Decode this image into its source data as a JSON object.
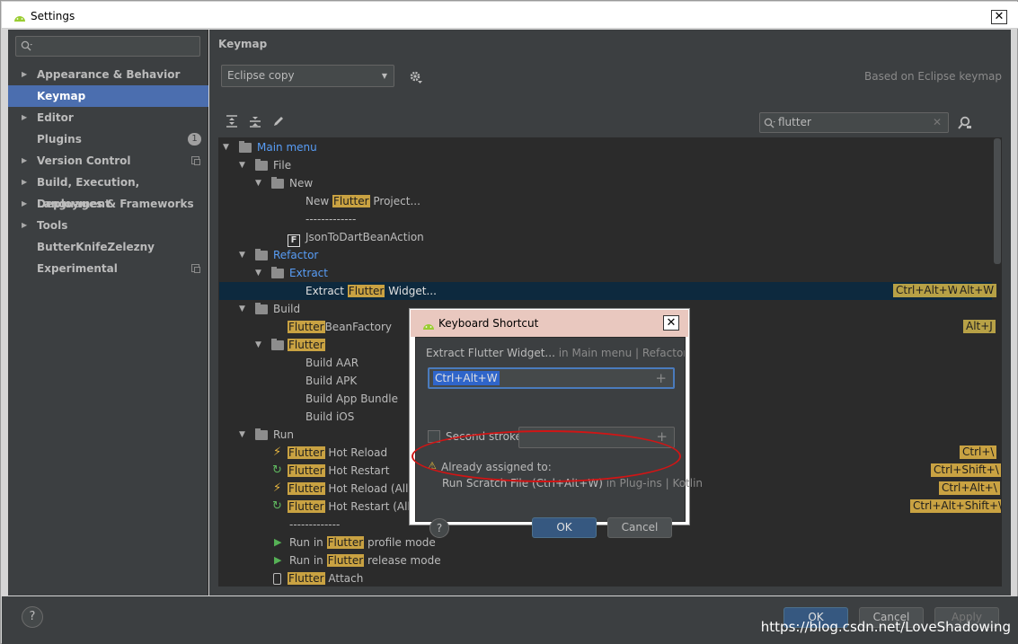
{
  "window": {
    "title": "Settings",
    "close": "✕"
  },
  "sidebar": {
    "search_placeholder": "",
    "items": [
      {
        "label": "Appearance & Behavior",
        "arrow": "▶"
      },
      {
        "label": "Keymap"
      },
      {
        "label": "Editor",
        "arrow": "▶"
      },
      {
        "label": "Plugins",
        "badge": "1"
      },
      {
        "label": "Version Control",
        "arrow": "▶"
      },
      {
        "label": "Build, Execution, Deployment",
        "arrow": "▶"
      },
      {
        "label": "Languages & Frameworks",
        "arrow": "▶"
      },
      {
        "label": "Tools",
        "arrow": "▶"
      },
      {
        "label": "ButterKnifeZelezny"
      },
      {
        "label": "Experimental"
      }
    ]
  },
  "main": {
    "heading": "Keymap",
    "keymap_select": "Eclipse copy",
    "based_on": "Based on Eclipse keymap",
    "filter_value": "flutter",
    "filter_clear": "✕"
  },
  "tree": {
    "main_menu": "Main menu",
    "file": "File",
    "new": "New",
    "new_flutter_project": {
      "pre": "New ",
      "hl": "Flutter",
      "post": " Project..."
    },
    "separator": "-------------",
    "json_to_dart": "JsonToDartBeanAction",
    "refactor": "Refactor",
    "extract": "Extract",
    "extract_widget": {
      "pre": "Extract ",
      "hl": "Flutter",
      "post": " Widget...",
      "sc1": "Ctrl+Alt+W",
      "sc2": "Alt+W"
    },
    "build": "Build",
    "flutter_bean_factory": {
      "hl": "Flutter",
      "post": "BeanFactory",
      "sc": "Alt+J"
    },
    "flutter_folder": {
      "hl": "Flutter"
    },
    "build_aar": "Build AAR",
    "build_apk": "Build APK",
    "build_app_bundle": "Build App Bundle",
    "build_ios": "Build iOS",
    "run": "Run",
    "hot_reload": {
      "hl": "Flutter",
      "post": " Hot Reload",
      "sc": "Ctrl+\\"
    },
    "hot_restart": {
      "hl": "Flutter",
      "post": " Hot Restart",
      "sc": "Ctrl+Shift+\\"
    },
    "hot_reload_all": {
      "hl": "Flutter",
      "post": " Hot Reload (All De",
      "sc": "Ctrl+Alt+\\"
    },
    "hot_restart_all": {
      "hl": "Flutter",
      "post": " Hot Restart (All De",
      "sc": "Ctrl+Alt+Shift+\\"
    },
    "separator2": "-------------",
    "run_profile": {
      "pre": "Run in ",
      "hl": "Flutter",
      "post": " profile mode"
    },
    "run_release": {
      "pre": "Run in ",
      "hl": "Flutter",
      "post": " release mode"
    },
    "attach": {
      "hl": "Flutter",
      "post": " Attach"
    }
  },
  "dialog": {
    "title": "Keyboard Shortcut",
    "close": "✕",
    "path_action": "Extract Flutter Widget...",
    "path_rest": " in Main menu | Refactor | Extrac",
    "first_stroke": "Ctrl+Alt+W",
    "second_stroke_label": "Second stroke:",
    "warning_title": "Already assigned to:",
    "conflict_action": "Run Scratch File (Ctrl+Alt+W)",
    "conflict_where": " in Plug-ins | Kotlin",
    "ok": "OK",
    "cancel": "Cancel",
    "help": "?"
  },
  "footer": {
    "help": "?",
    "ok": "OK",
    "cancel": "Cancel",
    "apply": "Apply"
  },
  "watermark": "https://blog.csdn.net/LoveShadowing",
  "colors": {
    "panel": "#3c3f41",
    "tree_bg": "#2b2b2b",
    "selection": "#4b6eaf",
    "highlight": "#c9a242",
    "link_blue": "#589df6",
    "callout": "#d11515"
  }
}
